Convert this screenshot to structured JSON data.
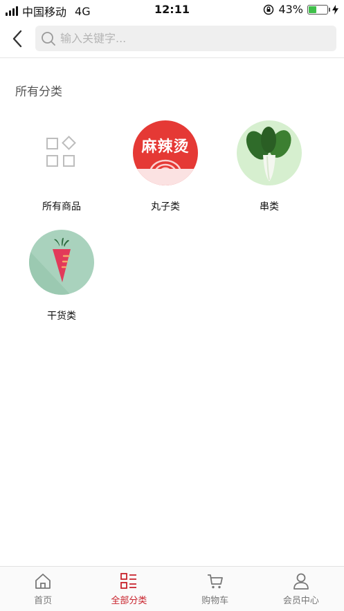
{
  "status_bar": {
    "carrier": "中国移动",
    "network": "4G",
    "time": "12:11",
    "battery_percent": "43%",
    "battery_level": 0.43
  },
  "header": {
    "back_icon": "chevron-left-icon",
    "search_placeholder": "输入关键字..."
  },
  "section": {
    "title": "所有分类"
  },
  "categories": [
    {
      "label": "所有商品",
      "icon": "grid-icon"
    },
    {
      "label": "丸子类",
      "icon": "mala-tang-image",
      "image_text": "麻辣烫"
    },
    {
      "label": "串类",
      "icon": "bok-choy-image"
    },
    {
      "label": "干货类",
      "icon": "carrot-image"
    }
  ],
  "tabbar": {
    "active_color": "#c8202a",
    "items": [
      {
        "label": "首页",
        "icon": "home-icon"
      },
      {
        "label": "全部分类",
        "icon": "category-list-icon",
        "active": true
      },
      {
        "label": "购物车",
        "icon": "cart-icon"
      },
      {
        "label": "会员中心",
        "icon": "user-icon"
      }
    ]
  }
}
